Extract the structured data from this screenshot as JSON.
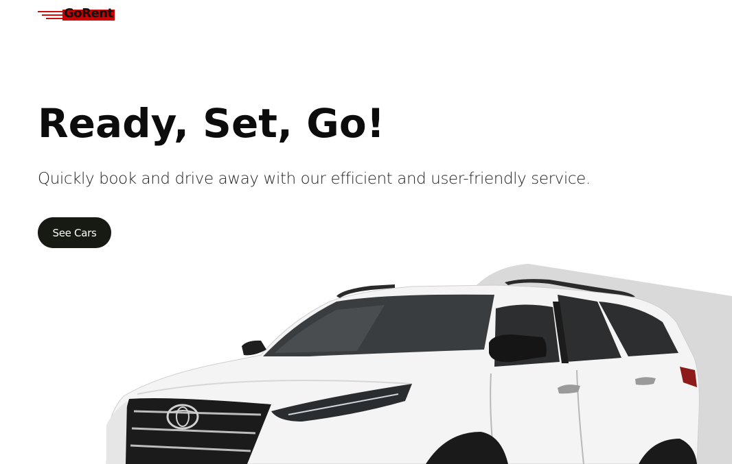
{
  "brand": {
    "logo_text": "GoRent",
    "accent_color": "#cc0000"
  },
  "hero": {
    "title": "Ready, Set, Go!",
    "subtitle": "Quickly book and drive away with our efficient and user-friendly service.",
    "cta_label": "See Cars"
  },
  "colors": {
    "text": "#0c0c0c",
    "button_bg": "#161a13",
    "button_text": "#ffffff",
    "backdrop": "#d9d9d9",
    "car_body": "#f4f4f4"
  },
  "images": {
    "hero_car": "white-suv-toyota-image"
  }
}
